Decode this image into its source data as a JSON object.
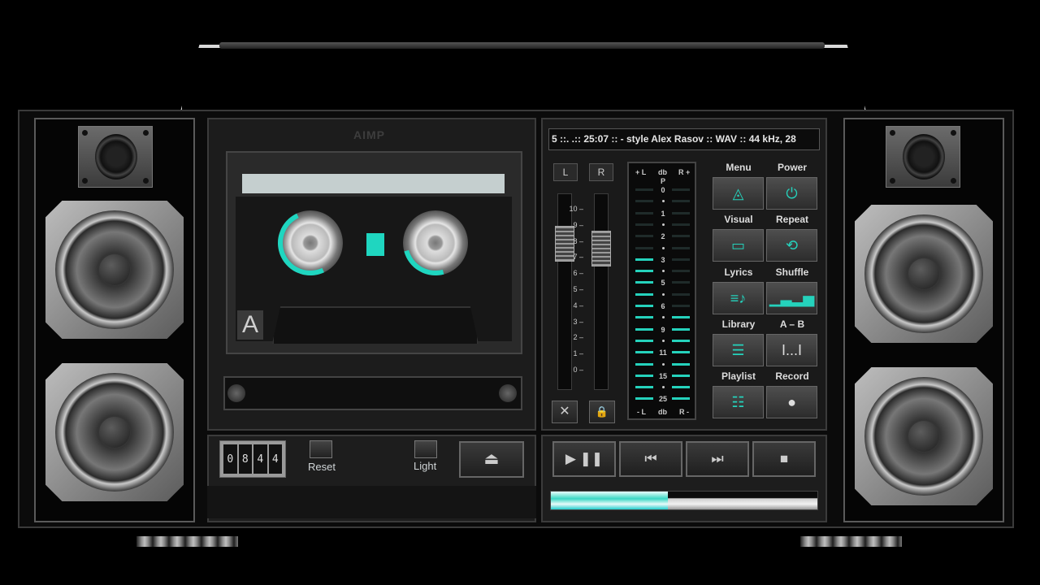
{
  "app": {
    "logo": "AIMP",
    "side_label": "A"
  },
  "ticker": {
    "text": "5 ::.       .:: 25:07 ::  - style Alex Rasov :: WAV :: 44 kHz, 28"
  },
  "counter": {
    "digits": [
      "0",
      "8",
      "4",
      "4"
    ]
  },
  "deck_controls": {
    "reset_label": "Reset",
    "light_label": "Light",
    "eject_symbol": "⏏"
  },
  "faders": {
    "left_label": "L",
    "right_label": "R",
    "scale": [
      "10",
      "9",
      "8",
      "7",
      "6",
      "5",
      "4",
      "3",
      "2",
      "1",
      "0"
    ],
    "close_symbol": "✕",
    "lock_symbol": "🔒",
    "left_level": 0.8,
    "right_level": 0.77
  },
  "vu_meter": {
    "header_left": "+ L",
    "header_mid": "db",
    "header_right": "R +",
    "footer_left": "- L",
    "footer_mid": "db",
    "footer_right": "R -",
    "peak_label": "P",
    "scale": [
      "0",
      "1",
      "2",
      "3",
      "5",
      "6",
      "9",
      "11",
      "15",
      "25"
    ],
    "accent": "#25d2bc"
  },
  "buttons": {
    "menu": {
      "label": "Menu",
      "icon": "menu-triangle-icon"
    },
    "power": {
      "label": "Power",
      "icon": "power-icon"
    },
    "visual": {
      "label": "Visual",
      "icon": "monitor-icon"
    },
    "repeat": {
      "label": "Repeat",
      "icon": "repeat-icon"
    },
    "lyrics": {
      "label": "Lyrics",
      "icon": "lyrics-icon"
    },
    "shuffle": {
      "label": "Shuffle",
      "icon": "equalizer-icon"
    },
    "library": {
      "label": "Library",
      "icon": "list-icon"
    },
    "ab": {
      "label": "A – B",
      "icon": "ab-repeat-icon"
    },
    "playlist": {
      "label": "Playlist",
      "icon": "playlist-icon"
    },
    "record": {
      "label": "Record",
      "icon": "record-icon"
    }
  },
  "transport": {
    "play_pause": "▶ ❚❚",
    "prev": "⏮",
    "next": "⏭",
    "stop": "■"
  },
  "progress": {
    "value": 0.44
  },
  "colors": {
    "accent": "#25d2bc",
    "background": "#000000"
  }
}
